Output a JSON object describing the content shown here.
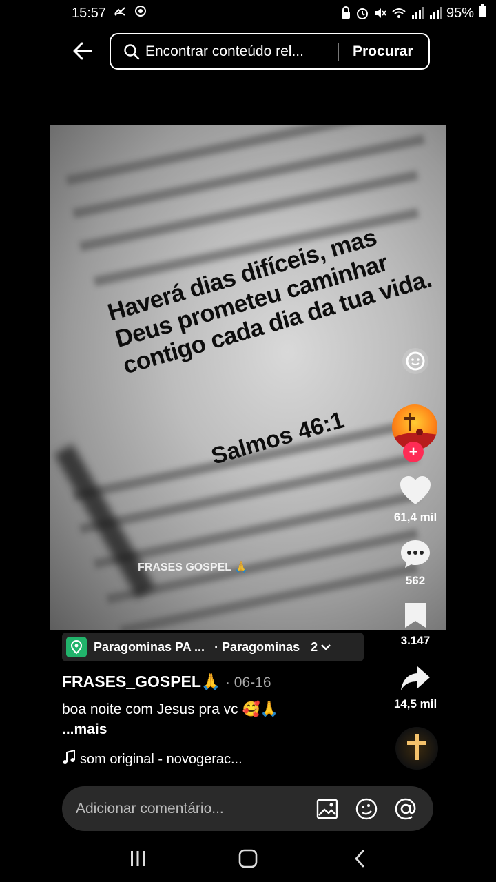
{
  "status_bar": {
    "time": "15:57",
    "battery": "95%"
  },
  "search": {
    "placeholder": "Encontrar conteúdo rel...",
    "button_label": "Procurar"
  },
  "video": {
    "quote_lines": [
      "Haverá dias difíceis, mas",
      "Deus prometeu caminhar",
      "contigo cada dia da tua vida."
    ],
    "reference": "Salmos 46:1",
    "watermark": "FRASES GOSPEL 🙏"
  },
  "actions": {
    "likes": "61,4 mil",
    "comments": "562",
    "saves": "3.147",
    "shares": "14,5 mil"
  },
  "location": {
    "name": "Paragominas PA ...",
    "subtitle": "· Paragominas",
    "count": "2"
  },
  "post": {
    "author": "FRASES_GOSPEL🙏",
    "date": "· 06-16",
    "caption": "boa noite  com Jesus pra vc 🥰🙏",
    "more_label": "...mais",
    "music": "som original - novogerac..."
  },
  "comment": {
    "placeholder": "Adicionar comentário..."
  },
  "colors": {
    "accent": "#fe2c55",
    "location_badge": "#21b36b"
  }
}
